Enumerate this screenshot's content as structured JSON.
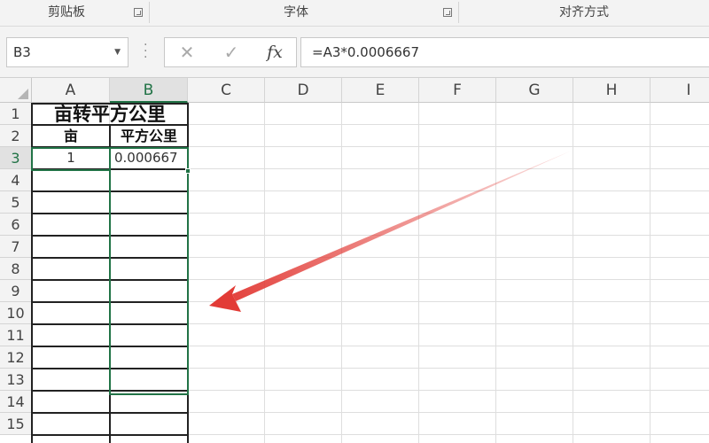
{
  "ribbon": {
    "groups": [
      {
        "label": "剪贴板"
      },
      {
        "label": "字体"
      },
      {
        "label": "对齐方式"
      }
    ]
  },
  "formula_bar": {
    "name_box": "B3",
    "cancel_icon": "✕",
    "enter_icon": "✓",
    "fx_label": "fx",
    "formula": "=A3*0.0006667"
  },
  "columns": [
    "A",
    "B",
    "C",
    "D",
    "E",
    "F",
    "G",
    "H",
    "I"
  ],
  "rows": [
    "1",
    "2",
    "3",
    "4",
    "5",
    "6",
    "7",
    "8",
    "9",
    "10",
    "11",
    "12",
    "13",
    "14",
    "15"
  ],
  "cells": {
    "title": "亩转平方公里",
    "header_a": "亩",
    "header_b": "平方公里",
    "a3": "1",
    "b3": "0.000667"
  },
  "annotation": {
    "arrow_color": "#e23b36"
  },
  "selection": {
    "active_cell": "B3",
    "accent_color": "#217346"
  }
}
